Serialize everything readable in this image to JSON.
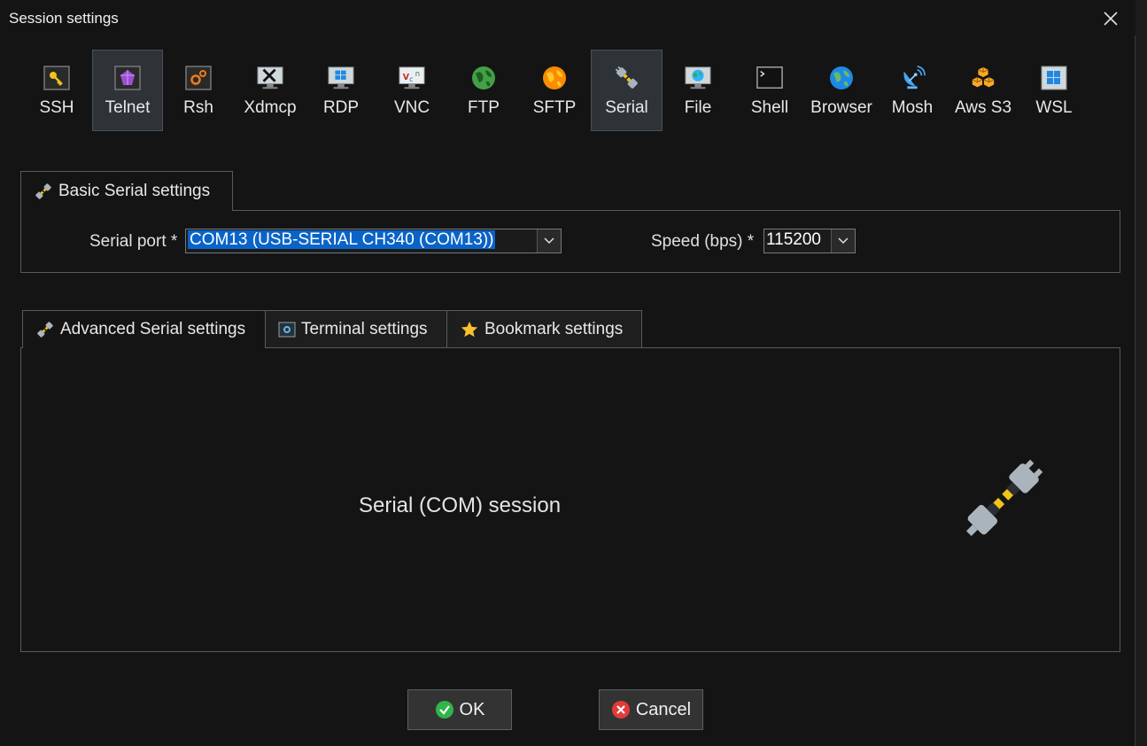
{
  "window": {
    "title": "Session settings"
  },
  "protocols": [
    {
      "label": "SSH",
      "icon": "key-icon",
      "selected": false
    },
    {
      "label": "Telnet",
      "icon": "telnet-gem-icon",
      "selected": false
    },
    {
      "label": "Rsh",
      "icon": "rsh-gears-icon",
      "selected": false
    },
    {
      "label": "Xdmcp",
      "icon": "x-monitor-icon",
      "selected": false
    },
    {
      "label": "RDP",
      "icon": "windows-monitor-icon",
      "selected": false
    },
    {
      "label": "VNC",
      "icon": "vnc-icon",
      "selected": false
    },
    {
      "label": "FTP",
      "icon": "green-globe-icon",
      "selected": false
    },
    {
      "label": "SFTP",
      "icon": "orange-globe-icon",
      "selected": false
    },
    {
      "label": "Serial",
      "icon": "serial-plug-icon",
      "selected": true
    },
    {
      "label": "File",
      "icon": "file-monitor-icon",
      "selected": false
    },
    {
      "label": "Shell",
      "icon": "terminal-icon",
      "selected": false
    },
    {
      "label": "Browser",
      "icon": "earth-globe-icon",
      "selected": false
    },
    {
      "label": "Mosh",
      "icon": "satellite-dish-icon",
      "selected": false
    },
    {
      "label": "Aws S3",
      "icon": "aws-cubes-icon",
      "selected": false
    },
    {
      "label": "WSL",
      "icon": "wsl-windows-icon",
      "selected": false
    }
  ],
  "basic": {
    "tab_label": "Basic Serial settings",
    "serial_port_label": "Serial port *",
    "serial_port_value": "COM13  (USB-SERIAL CH340 (COM13))",
    "speed_label": "Speed (bps) *",
    "speed_value": "115200"
  },
  "lower_tabs": [
    {
      "label": "Advanced Serial settings",
      "icon": "serial-plug-icon"
    },
    {
      "label": "Terminal settings",
      "icon": "terminal-settings-icon"
    },
    {
      "label": "Bookmark settings",
      "icon": "star-icon"
    }
  ],
  "session_description": "Serial (COM) session",
  "buttons": {
    "ok": "OK",
    "cancel": "Cancel"
  },
  "colors": {
    "selected_highlight": "#0a64c8",
    "ok_green": "#2fb54a",
    "cancel_red": "#e23b3b"
  }
}
